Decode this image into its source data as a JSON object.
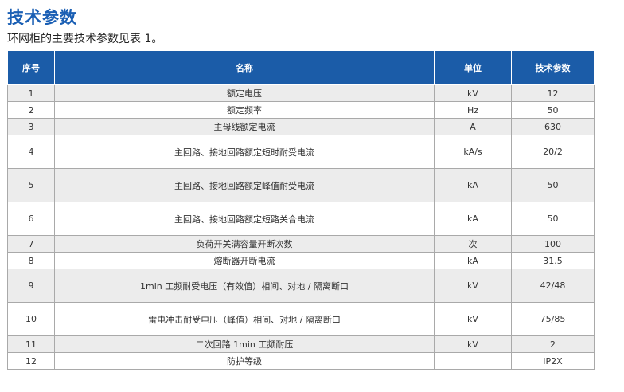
{
  "header": {
    "title": "技术参数",
    "intro": "环网柜的主要技术参数见表 1。"
  },
  "table": {
    "columns": [
      "序号",
      "名称",
      "单位",
      "技术参数"
    ],
    "rows": [
      {
        "no": "1",
        "name": "额定电压",
        "unit": "kV",
        "value": "12"
      },
      {
        "no": "2",
        "name": "额定频率",
        "unit": "Hz",
        "value": "50"
      },
      {
        "no": "3",
        "name": "主母线额定电流",
        "unit": "A",
        "value": "630"
      },
      {
        "no": "4",
        "name": "主回路、接地回路额定短时耐受电流",
        "unit": "kA/s",
        "value": "20/2"
      },
      {
        "no": "5",
        "name": "主回路、接地回路额定峰值耐受电流",
        "unit": "kA",
        "value": "50"
      },
      {
        "no": "6",
        "name": "主回路、接地回路额定短路关合电流",
        "unit": "kA",
        "value": "50"
      },
      {
        "no": "7",
        "name": "负荷开关满容量开断次数",
        "unit": "次",
        "value": "100"
      },
      {
        "no": "8",
        "name": "熔断器开断电流",
        "unit": "kA",
        "value": "31.5"
      },
      {
        "no": "9",
        "name": "1min 工频耐受电压（有效值）相间、对地 / 隔离断口",
        "unit": "kV",
        "value": "42/48"
      },
      {
        "no": "10",
        "name": "雷电冲击耐受电压（峰值）相间、对地 / 隔离断口",
        "unit": "kV",
        "value": "75/85"
      },
      {
        "no": "11",
        "name": "二次回路 1min 工频耐压",
        "unit": "kV",
        "value": "2"
      },
      {
        "no": "12",
        "name": "防护等级",
        "unit": "",
        "value": "IP2X"
      }
    ]
  },
  "colors": {
    "title": "#1a5fb4",
    "header_bg": "#1b5ca8",
    "row_odd": "#ececec",
    "row_even": "#ffffff",
    "border": "#a9a9a9"
  }
}
